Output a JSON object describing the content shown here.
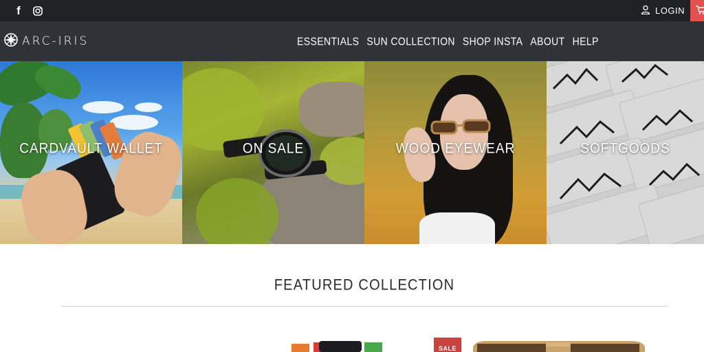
{
  "topbar": {
    "social_icons": [
      "facebook-icon",
      "instagram-icon"
    ],
    "login_label": "LOGIN",
    "accent_color": "#e0514f"
  },
  "header": {
    "logo_text": "ARC-IRIS",
    "nav": [
      {
        "label": "ESSENTIALS"
      },
      {
        "label": "SUN COLLECTION"
      },
      {
        "label": "SHOP INSTA"
      },
      {
        "label": "ABOUT"
      },
      {
        "label": "HELP"
      }
    ]
  },
  "tiles": [
    {
      "label": "CARDVAULT WALLET"
    },
    {
      "label": "ON SALE"
    },
    {
      "label": "WOOD EYEWEAR"
    },
    {
      "label": "SOFTGOODS"
    }
  ],
  "featured": {
    "title": "FEATURED COLLECTION",
    "sale_badge": "SALE"
  }
}
